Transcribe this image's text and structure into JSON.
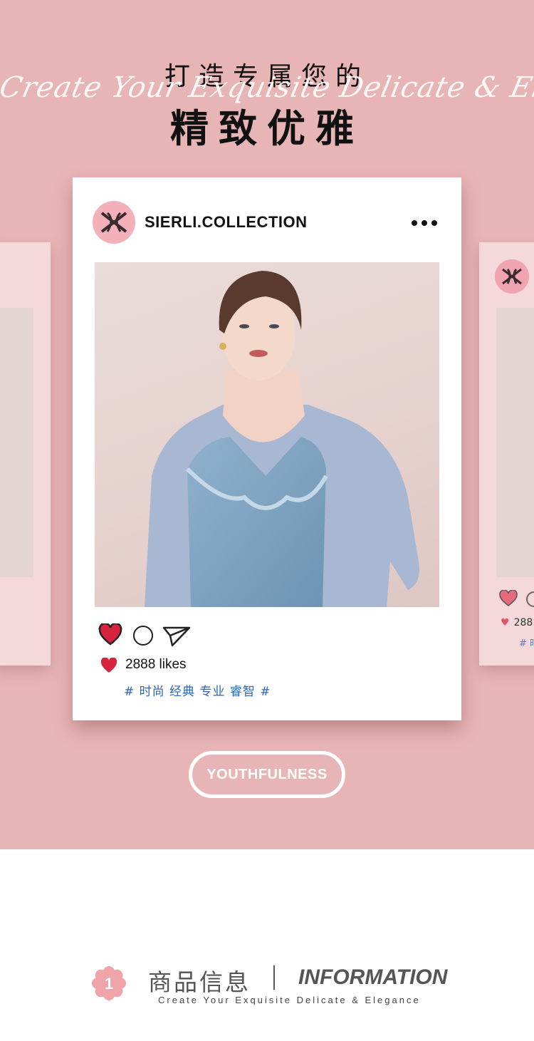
{
  "header": {
    "line1": "打造专属您的",
    "script": "Create Your Exquisite Delicate & Elegance",
    "line2": "精致优雅"
  },
  "post": {
    "account": "SIERLI.COLLECTION",
    "likes": "2888 likes",
    "tags": "# 时尚 经典 专业 睿智 #"
  },
  "side_right": {
    "likes": "288",
    "tag": "# 时"
  },
  "badge": {
    "label": "YOUTHFULNESS"
  },
  "section": {
    "number": "1",
    "title_cn": "商品信息",
    "title_en": "INFORMATION",
    "subtitle": "Create Your Exquisite Delicate & Elegance"
  },
  "icons": {
    "menu": "more-dots-icon",
    "like": "heart-icon",
    "comment": "comment-circle-icon",
    "share": "paper-plane-icon",
    "brand": "sierli-logo-icon"
  },
  "colors": {
    "background_pink": "#e8b5b7",
    "heart_red": "#d8233f",
    "tag_blue": "#2b66b8",
    "avatar_pink": "#f3b0bb"
  }
}
